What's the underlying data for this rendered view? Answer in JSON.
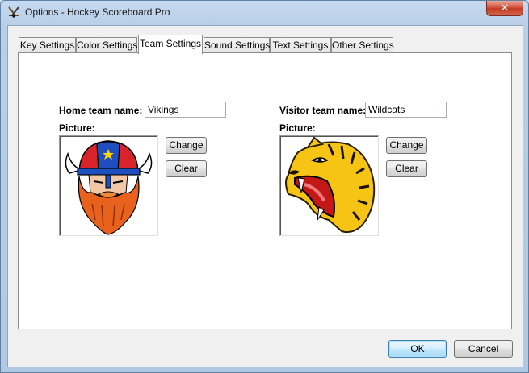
{
  "window": {
    "title": "Options - Hockey Scoreboard Pro",
    "close_label": "✕"
  },
  "tabs": [
    {
      "label": "Key Settings",
      "active": false
    },
    {
      "label": "Color Settings",
      "active": false
    },
    {
      "label": "Team Settings",
      "active": true
    },
    {
      "label": "Sound Settings",
      "active": false
    },
    {
      "label": "Text Settings",
      "active": false
    },
    {
      "label": "Other Settings",
      "active": false
    }
  ],
  "home": {
    "name_label": "Home team name:",
    "name_value": "Vikings",
    "picture_label": "Picture:",
    "picture_icon": "viking-logo-image",
    "change_label": "Change",
    "clear_label": "Clear"
  },
  "visitor": {
    "name_label": "Visitor team name:",
    "name_value": "Wildcats",
    "picture_label": "Picture:",
    "picture_icon": "wildcat-logo-image",
    "change_label": "Change",
    "clear_label": "Clear"
  },
  "footer": {
    "ok_label": "OK",
    "cancel_label": "Cancel"
  },
  "colors": {
    "window_frame": "#b9cfe8",
    "client_bg": "#f0f0f0",
    "close_button": "#c23a22",
    "default_button_border": "#3c7fb1"
  }
}
